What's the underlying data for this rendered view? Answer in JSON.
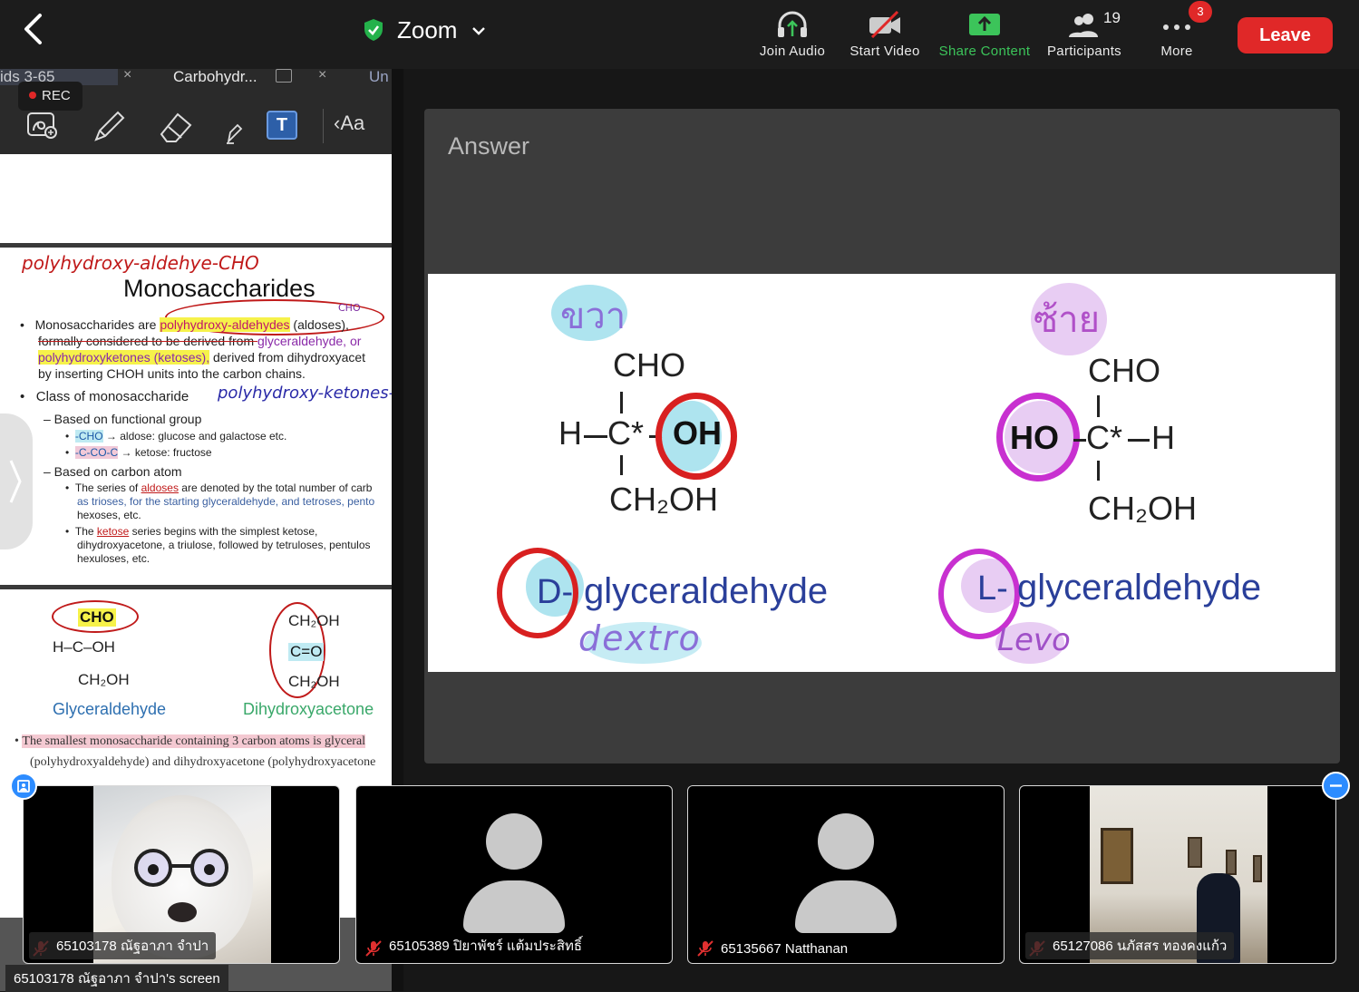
{
  "topbar": {
    "app_name": "Zoom",
    "join_audio": "Join Audio",
    "start_video": "Start Video",
    "share_content": "Share Content",
    "participants": "Participants",
    "participants_count": "19",
    "more": "More",
    "more_badge": "3",
    "leave": "Leave",
    "colors": {
      "leave": "#e02828",
      "share": "#3cc45a",
      "shield": "#24b24b"
    }
  },
  "tabs": [
    {
      "label": "ids 3-65"
    },
    {
      "label": "Carbohydr..."
    },
    {
      "label": "Un"
    }
  ],
  "toolbar": {
    "rec_label": "REC",
    "text_tool": "T",
    "aa_label": "‹Aa"
  },
  "doc": {
    "annotation_top": "polyhydroxy-aldehye-CHO",
    "heading": "Monosaccharides",
    "circle_note": "CHO",
    "bullet1_a": "Monosaccharides are ",
    "bullet1_hl": "polyhydroxy-aldehydes",
    "bullet1_b": " (aldoses),",
    "bullet1_line2a": "formally considered to be derived from ",
    "bullet1_line2b": "glyceraldehyde, or",
    "bullet1_line3a": "polyhydroxyketones (ketoses),",
    "bullet1_line3b": " derived from dihydroxyacet",
    "bullet1_line4": "by inserting CHOH units into the carbon chains.",
    "bullet2": "Class of monosaccharide",
    "annotation_ketones": "polyhydroxy-ketones-C",
    "sub1": "– Based on functional group",
    "sub1a_code": "-CHO",
    "sub1a_text": "→ aldose: glucose and galactose etc.",
    "sub1b_code": "-C-CO-C",
    "sub1b_text": "→ ketose: fructose",
    "sub2": "– Based on carbon atom",
    "sub2a_line1a": "The series of ",
    "sub2a_line1b": "aldoses",
    "sub2a_line1c": " are denoted by the total number of carb",
    "sub2a_line2": "as trioses, for the starting glyceraldehyde, and tetroses, pento",
    "sub2a_line3": "hexoses, etc.",
    "sub2b_line1a": "The ",
    "sub2b_line1b": "ketose",
    "sub2b_line1c": " series begins with the simplest ketose,",
    "sub2b_line2": "dihydroxyacetone, a triulose, followed by tetruloses, pentulos",
    "sub2b_line3": "hexuloses, etc.",
    "glyc_cho": "CHO",
    "glyc_mid": "H–C–OH",
    "glyc_bot": "CH₂OH",
    "glyc_label": "Glyceraldehyde",
    "dhya_top": "CH₂OH",
    "dhya_mid": "C=O",
    "dhya_bot": "CH₂OH",
    "dhya_label": "Dihydroxyacetone",
    "bottom_line1": "The smallest monosaccharide containing 3 carbon atoms is glyceral",
    "bottom_line2": "(polyhydroxyaldehyde) and dihydroxyacetone (polyhydroxyacetone"
  },
  "slide": {
    "title": "Answer",
    "left_top_handwriting": "ขวา",
    "right_top_handwriting": "ซ้าย",
    "left_cho": "CHO",
    "left_h": "H",
    "left_c": "C*",
    "left_oh": "OH",
    "left_bottom": "CH₂OH",
    "right_cho": "CHO",
    "right_ho": "HO",
    "right_c": "C*",
    "right_h": "H",
    "right_bottom": "CH₂OH",
    "d_letter": "D-",
    "d_name": "glyceraldehyde",
    "d_hand": "dextro",
    "l_letter": "L-",
    "l_name": "glyceraldehyde",
    "l_hand": "Levo"
  },
  "participants": [
    {
      "name": "65103178 ณัฐอาภา จำปา",
      "type": "video-dog"
    },
    {
      "name": "65105389 ปิยาพัชร์ แต้มประสิทธิ์",
      "type": "avatar"
    },
    {
      "name": "65135667 Natthanan",
      "type": "avatar"
    },
    {
      "name": "65127086 นภัสสร ทองคงแก้ว",
      "type": "video-room"
    }
  ],
  "screen_label": "65103178 ณัฐอาภา จำปา's screen"
}
